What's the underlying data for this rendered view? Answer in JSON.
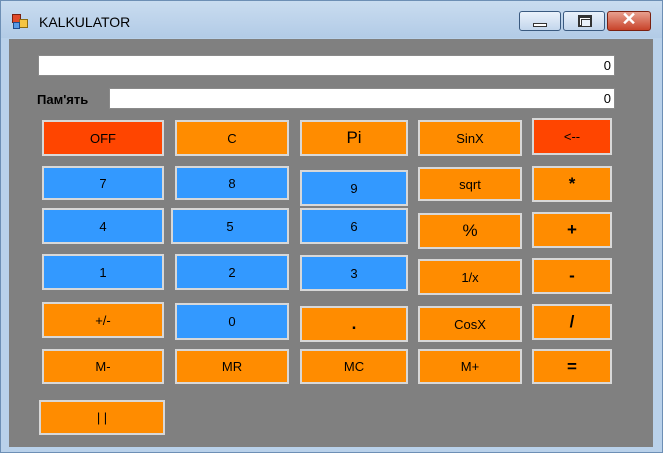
{
  "window": {
    "title": "KALKULATOR"
  },
  "display": {
    "value": "0"
  },
  "memory": {
    "label": "Пам'ять",
    "value": "0"
  },
  "buttons": {
    "off": "OFF",
    "c": "C",
    "pi": "Pi",
    "sinx": "SinX",
    "back": "<--",
    "n7": "7",
    "n8": "8",
    "n9": "9",
    "sqrt": "sqrt",
    "mul": "*",
    "n4": "4",
    "n5": "5",
    "n6": "6",
    "percent": "%",
    "plus": "+",
    "n1": "1",
    "n2": "2",
    "n3": "3",
    "inv": "1/x",
    "minus": "-",
    "sign": "+/-",
    "n0": "0",
    "dot": ".",
    "cosx": "CosX",
    "div": "/",
    "mminus": "M-",
    "mr": "MR",
    "mc": "MC",
    "mplus": "M+",
    "eq": "=",
    "abs": "| |"
  },
  "colors": {
    "orange": "#ff8c00",
    "red": "#ff4500",
    "blue": "#3399ff",
    "background": "#808080"
  },
  "icons": [
    "app-icon",
    "minimize-icon",
    "maximize-icon",
    "close-icon"
  ]
}
